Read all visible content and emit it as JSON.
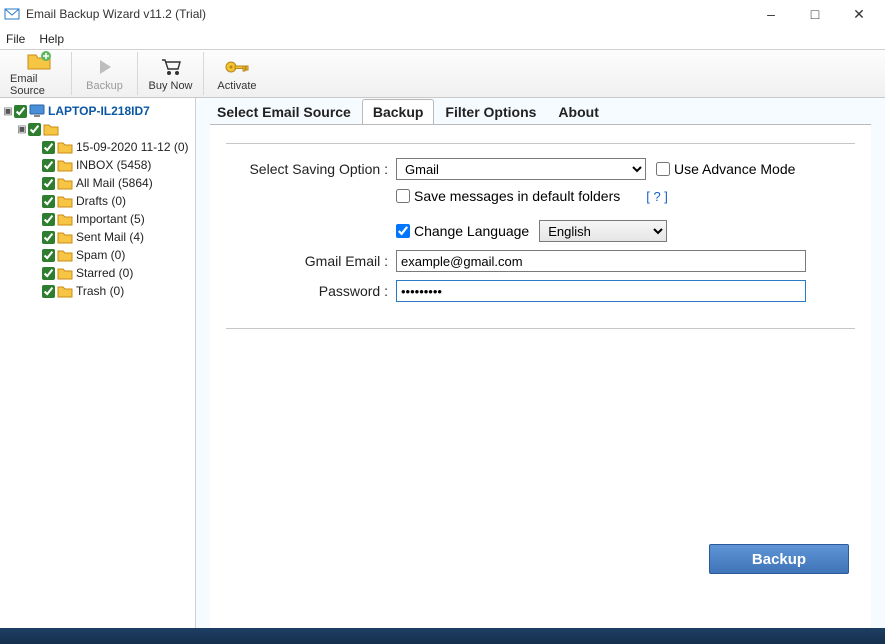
{
  "titlebar": {
    "title": "Email Backup Wizard v11.2 (Trial)"
  },
  "menubar": {
    "file": "File",
    "help": "Help"
  },
  "toolbar": {
    "email_source": "Email Source",
    "backup": "Backup",
    "buy_now": "Buy Now",
    "activate": "Activate"
  },
  "tree": {
    "root": "LAPTOP-IL218ID7",
    "items": [
      {
        "label": "15-09-2020 11-12 (0)"
      },
      {
        "label": "INBOX (5458)"
      },
      {
        "label": "All Mail (5864)"
      },
      {
        "label": "Drafts (0)"
      },
      {
        "label": "Important (5)"
      },
      {
        "label": "Sent Mail (4)"
      },
      {
        "label": "Spam (0)"
      },
      {
        "label": "Starred (0)"
      },
      {
        "label": "Trash (0)"
      }
    ]
  },
  "tabs": {
    "select_source": "Select Email Source",
    "backup": "Backup",
    "filter": "Filter Options",
    "about": "About"
  },
  "form": {
    "select_saving_label": "Select Saving Option  :",
    "saving_value": "Gmail",
    "advance_mode": "Use Advance Mode",
    "default_folders": "Save messages in default folders",
    "help": "[ ? ]",
    "change_language": "Change Language",
    "lang_value": "English",
    "email_label": "Gmail Email  :",
    "email_value": "example@gmail.com",
    "password_label": "Password  :",
    "password_value": "•••••••••",
    "backup_button": "Backup"
  }
}
